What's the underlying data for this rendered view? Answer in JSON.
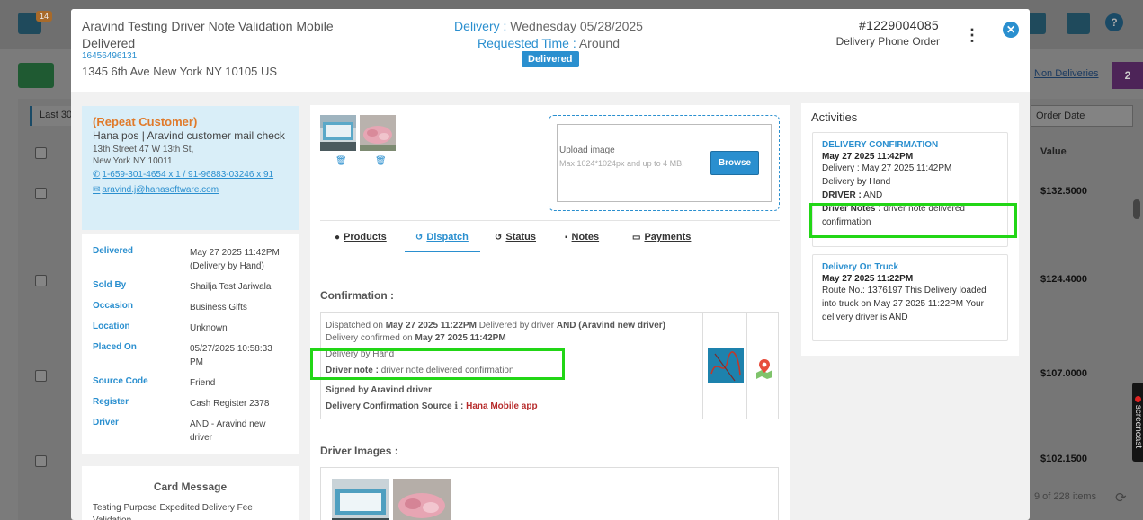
{
  "background": {
    "badge_count": "14",
    "help_glyph": "?",
    "non_deliveries_link": "Non Deliveries",
    "non_deliveries_count": "2",
    "last_filter": "Last 30",
    "order_date_select": "Order Date",
    "value_header": "Value",
    "row_values": [
      "$132.5000",
      "$124.4000",
      "$107.0000",
      "$102.1500"
    ],
    "items_count": "9 of 228 items",
    "screencast_label": "screencast"
  },
  "header": {
    "customer_name": "Aravind Testing Driver Note Validation Mobile",
    "status_text": "Delivered",
    "phone": "16456496131",
    "address": "1345 6th Ave New York NY 10105 US",
    "delivery_label": "Delivery :",
    "delivery_value": "Wednesday 05/28/2025",
    "requested_label": "Requested Time :",
    "requested_value": "Around",
    "status_badge": "Delivered",
    "order_number": "#1229004085",
    "order_type": "Delivery Phone Order"
  },
  "customer": {
    "repeat_label": "(Repeat Customer)",
    "name_line": "Hana pos | Aravind customer mail check",
    "street": "13th Street 47 W 13th St,",
    "city": "New York NY 10011",
    "phones": "1-659-301-4654 x 1 / 91-96883-03246 x 91",
    "email": "aravind.j@hanasoftware.com"
  },
  "info_rows": [
    {
      "key": "Delivered",
      "value": "May 27 2025 11:42PM (Delivery by Hand)"
    },
    {
      "key": "Sold By",
      "value": "Shailja Test Jariwala"
    },
    {
      "key": "Occasion",
      "value": "Business Gifts"
    },
    {
      "key": "Location",
      "value": "Unknown"
    },
    {
      "key": "Placed On",
      "value": "05/27/2025 10:58:33 PM"
    },
    {
      "key": "Source Code",
      "value": "Friend"
    },
    {
      "key": "Register",
      "value": "Cash Register 2378"
    },
    {
      "key": "Driver",
      "value": "AND - Aravind new driver"
    }
  ],
  "card_message": {
    "title": "Card Message",
    "body": "Testing Purpose Expedited Delivery Fee Validation"
  },
  "upload": {
    "label": "Upload image",
    "hint": "Max 1024*1024px and up to 4 MB.",
    "browse": "Browse"
  },
  "tabs": [
    "Products",
    "Dispatch",
    "Status",
    "Notes",
    "Payments"
  ],
  "confirmation": {
    "title": "Confirmation :",
    "dispatched_prefix": "Dispatched on",
    "dispatched_date": "May 27 2025 11:22PM",
    "delivered_by": "Delivered by driver",
    "driver_name": "AND (Aravind new driver)",
    "confirmed_on": "Delivery confirmed on",
    "confirmed_date": "May 27 2025 11:42PM",
    "delivery_by": "Delivery by Hand",
    "driver_note_label": "Driver note :",
    "driver_note": "driver note delivered confirmation",
    "signed_by": "Signed by Aravind driver",
    "source_label": "Delivery Confirmation Source",
    "source_value": "Hana Mobile app"
  },
  "driver_images_title": "Driver Images :",
  "activities": {
    "title": "Activities",
    "items": [
      {
        "heading": "DELIVERY CONFIRMATION",
        "date": "May 27 2025 11:42PM",
        "line1": "Delivery : May 27 2025 11:42PM",
        "line2": "Delivery by Hand",
        "driver_label": "DRIVER :",
        "driver_value": "AND",
        "notes_label": "Driver Notes :",
        "notes_value": "driver note delivered confirmation"
      },
      {
        "heading": "Delivery On Truck",
        "date": "May 27 2025 11:22PM",
        "body": "Route No.: 1376197 This Delivery loaded into truck on May 27 2025 11:22PM Your delivery driver is AND"
      }
    ]
  },
  "colors": {
    "accent": "#2a8fcf",
    "repeat_customer": "#e07a2a",
    "highlight": "#22d616",
    "source_red": "#b72c2c"
  }
}
